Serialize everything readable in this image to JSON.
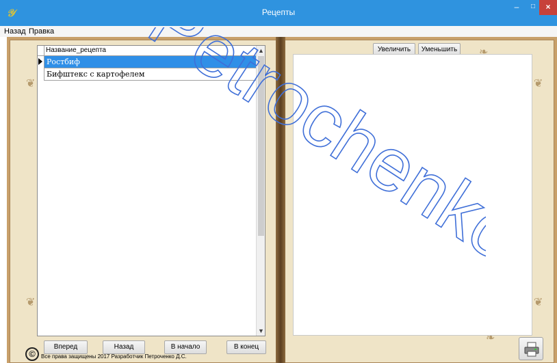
{
  "window": {
    "title": "Рецепты",
    "app_icon": "𝒴",
    "minimize": "–",
    "maximize": "□",
    "close": "×"
  },
  "menu": {
    "items": [
      "Назад",
      "Правка"
    ]
  },
  "grid": {
    "column_header": "Название_рецепта",
    "rows": [
      "Ростбиф",
      "Бифштекс с картофелем"
    ],
    "selected_row": 0
  },
  "nav_buttons": {
    "forward": "Вперед",
    "back": "Назад",
    "start": "В начало",
    "end": "В конец"
  },
  "zoom_buttons": {
    "zoom_in": "Увеличить",
    "zoom_out": "Уменьшить"
  },
  "footer": {
    "copyright_symbol": "©",
    "copyright_text": "Все права защищены 2017 Разработчик Петроченко Д.С."
  },
  "watermark_text": "Petrochenko",
  "icons": {
    "print": "printer-icon"
  },
  "colors": {
    "titlebar": "#2f93df",
    "selection": "#2f8fe7",
    "close_button": "#c7413a",
    "watermark": "#3f6fd8"
  }
}
